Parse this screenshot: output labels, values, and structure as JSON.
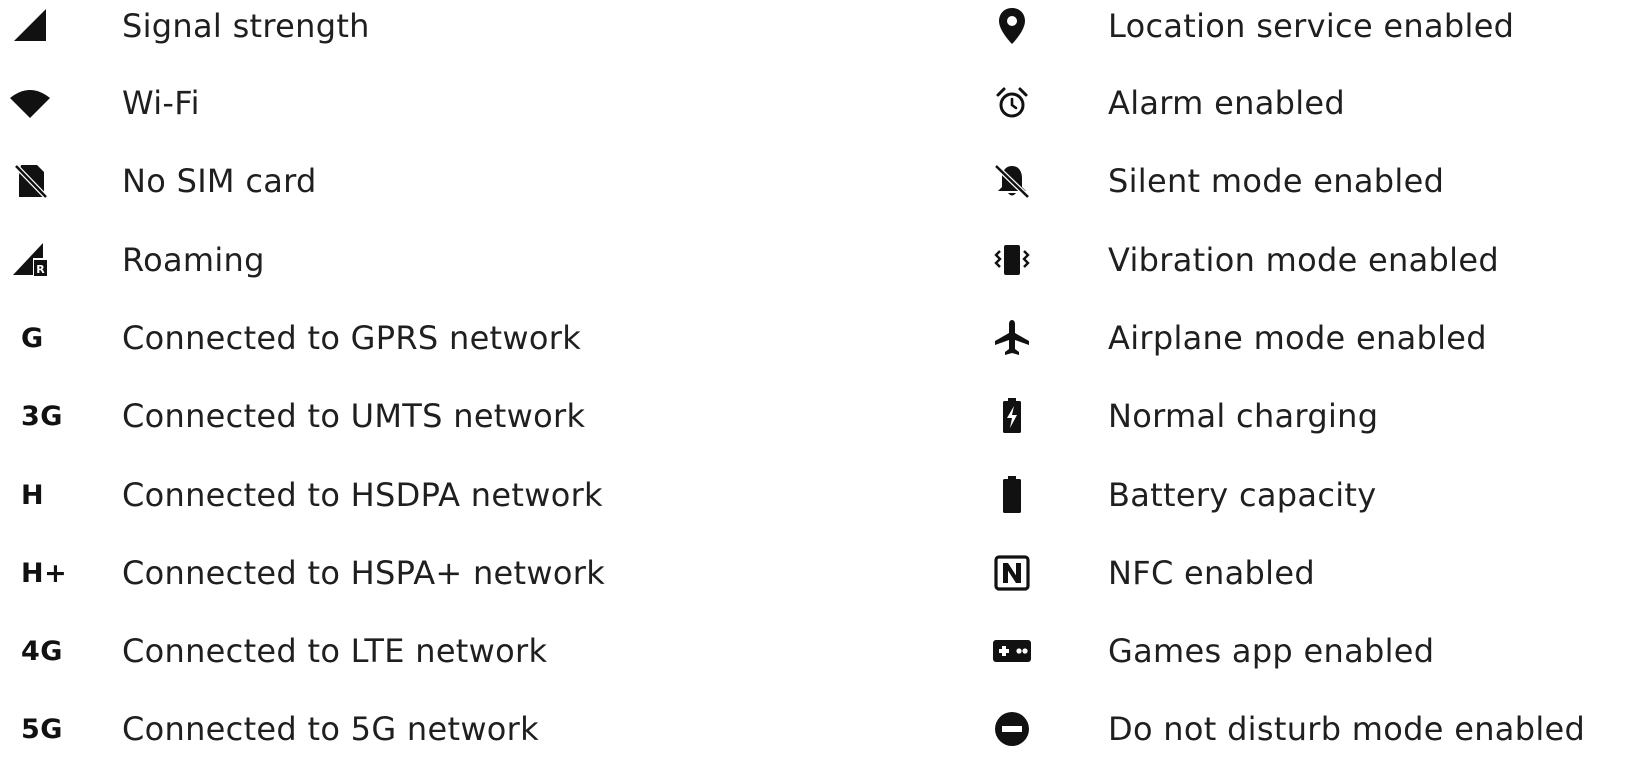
{
  "left_items": [
    {
      "icon": "signal-strength-icon",
      "label": "Signal strength"
    },
    {
      "icon": "wifi-icon",
      "label": "Wi-Fi"
    },
    {
      "icon": "no-sim-card-icon",
      "label": "No SIM card"
    },
    {
      "icon": "roaming-icon",
      "label": "Roaming"
    },
    {
      "icon_text": "G",
      "label": "Connected to GPRS network"
    },
    {
      "icon_text": "3G",
      "label": "Connected to UMTS network"
    },
    {
      "icon_text": "H",
      "label": "Connected to HSDPA network"
    },
    {
      "icon_text": "H+",
      "label": "Connected to HSPA+ network"
    },
    {
      "icon_text": "4G",
      "label": "Connected to LTE network"
    },
    {
      "icon_text": "5G",
      "label": "Connected to 5G network"
    }
  ],
  "right_items": [
    {
      "icon": "location-pin-icon",
      "label": "Location service enabled"
    },
    {
      "icon": "alarm-clock-icon",
      "label": "Alarm enabled"
    },
    {
      "icon": "bell-off-icon",
      "label": "Silent mode enabled"
    },
    {
      "icon": "vibration-icon",
      "label": "Vibration mode enabled"
    },
    {
      "icon": "airplane-icon",
      "label": "Airplane mode enabled"
    },
    {
      "icon": "battery-charging-icon",
      "label": "Normal charging"
    },
    {
      "icon": "battery-full-icon",
      "label": "Battery capacity"
    },
    {
      "icon": "nfc-icon",
      "label": "NFC enabled"
    },
    {
      "icon": "gamepad-icon",
      "label": "Games app enabled"
    },
    {
      "icon": "do-not-disturb-icon",
      "label": "Do not disturb mode enabled"
    }
  ]
}
